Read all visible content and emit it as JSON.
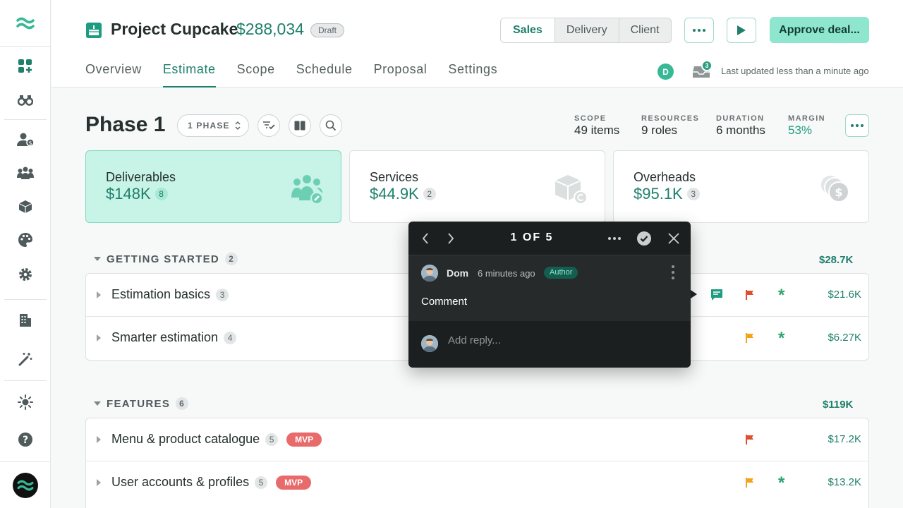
{
  "project": {
    "title": "Project Cupcake",
    "amount": "$288,034",
    "status": "Draft"
  },
  "view_switch": [
    "Sales",
    "Delivery",
    "Client"
  ],
  "header_actions": {
    "more_icon": "ellipsis-icon",
    "present_icon": "play-icon",
    "approve_label": "Approve deal..."
  },
  "tabs": [
    "Overview",
    "Estimate",
    "Scope",
    "Schedule",
    "Proposal",
    "Settings"
  ],
  "active_tab": "Estimate",
  "presence": {
    "user_initial": "D",
    "inbox_count": "3",
    "last_updated": "Last updated less than a minute ago"
  },
  "phase": {
    "title": "Phase 1",
    "selector_label": "1 PHASE",
    "stats": [
      {
        "label": "SCOPE",
        "value": "49 items"
      },
      {
        "label": "RESOURCES",
        "value": "9 roles"
      },
      {
        "label": "DURATION",
        "value": "6 months"
      },
      {
        "label": "MARGIN",
        "value": "53%"
      }
    ]
  },
  "cards": [
    {
      "name": "Deliverables",
      "value": "$148K",
      "count": "8",
      "active": true,
      "icon": "team-icon"
    },
    {
      "name": "Services",
      "value": "$44.9K",
      "count": "2",
      "active": false,
      "icon": "box-icon"
    },
    {
      "name": "Overheads",
      "value": "$95.1K",
      "count": "3",
      "active": false,
      "icon": "coins-icon"
    }
  ],
  "sections": [
    {
      "title": "GETTING STARTED",
      "count": "2",
      "total": "$28.7K",
      "rows": [
        {
          "name": "Estimation basics",
          "count": "3",
          "price": "$21.6K",
          "flag": "red",
          "asterisk": true,
          "comment": true
        },
        {
          "name": "Smarter estimation",
          "count": "4",
          "price": "$6.27K",
          "flag": "orange",
          "asterisk": true,
          "comment": false
        }
      ]
    },
    {
      "title": "FEATURES",
      "count": "6",
      "total": "$119K",
      "rows": [
        {
          "name": "Menu & product catalogue",
          "count": "5",
          "badge": "MVP",
          "price": "$17.2K",
          "flag": "red",
          "asterisk": false
        },
        {
          "name": "User accounts & profiles",
          "count": "5",
          "badge": "MVP",
          "price": "$13.2K",
          "flag": "orange",
          "asterisk": true
        }
      ]
    }
  ],
  "comment_popover": {
    "counter": "1 OF 5",
    "author": "Dom",
    "time": "6 minutes ago",
    "role": "Author",
    "text": "Comment",
    "reply_placeholder": "Add reply..."
  },
  "colors": {
    "brand": "#1e7f6b",
    "accent": "#8ee6cf",
    "flag_red": "#e04e2e",
    "flag_orange": "#f2a31b",
    "mvp": "#e86a6a"
  }
}
